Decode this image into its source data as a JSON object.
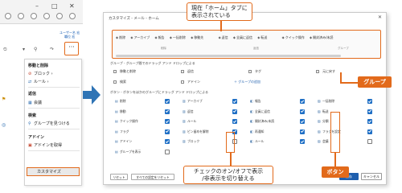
{
  "left": {
    "window_controls": [
      "–",
      "□",
      "✕"
    ],
    "user_line1": "ユーザー名 宏",
    "user_line2": "職位 宏",
    "more_button": "···",
    "menu": {
      "move_delete_header": "移動と削除",
      "block": "ブロック",
      "rule": "ルール",
      "reply_header": "返信",
      "meeting": "会議",
      "search_header": "検索",
      "find_group": "グループを見つける",
      "addin_header": "アドイン",
      "get_addins": "アドインを取得",
      "customize": "カスタマイズ"
    }
  },
  "dialog": {
    "title": "カスタマイズ - メール - ホーム",
    "qat_items": [
      "削除",
      "アーカイブ",
      "報告",
      "一括削除",
      "移動先",
      "返信",
      "全員に返信",
      "転送",
      "クイック操作",
      "開封済み/未読"
    ],
    "qat_groups": [
      "削除",
      "返信",
      "グループ"
    ],
    "groups_label": "グループ - グループ間でのドラッグ アンド ドロップによる",
    "groups": [
      "移動と削除",
      "返信",
      "タグ",
      "元に戻す",
      "検索",
      "アドイン",
      "＋ グループの追加"
    ],
    "buttons_label": "ボタン - ボタンをほかのグループにドラッグ アンド ドロップによる",
    "buttons": [
      [
        {
          "label": "削除",
          "on": true
        },
        {
          "label": "アーカイブ",
          "on": true
        },
        {
          "label": "報告",
          "on": true
        },
        {
          "label": "一括削除",
          "on": true
        }
      ],
      [
        {
          "label": "移動",
          "on": true
        },
        {
          "label": "返信",
          "on": true
        },
        {
          "label": "全員に返信",
          "on": true
        },
        {
          "label": "転送",
          "on": true
        }
      ],
      [
        {
          "label": "クイック操作",
          "on": true
        },
        {
          "label": "ルール",
          "on": true
        },
        {
          "label": "開封済み/未読",
          "on": true
        },
        {
          "label": "分類",
          "on": true
        }
      ],
      [
        {
          "label": "フラグ",
          "on": true
        },
        {
          "label": "ピン留めを解除",
          "on": true
        },
        {
          "label": "再通知",
          "on": true
        },
        {
          "label": "フラグを設定",
          "on": true
        }
      ],
      [
        {
          "label": "アドイン",
          "on": true
        },
        {
          "label": "ブロック",
          "on": false
        },
        {
          "label": "ルール",
          "on": true
        },
        {
          "label": "会議",
          "on": false
        }
      ],
      [
        {
          "label": "グループを表示",
          "on": false
        }
      ]
    ],
    "reset_label": "リセット",
    "reset_all_label": "すべての設定をリセット",
    "save_label": "保存",
    "cancel_label": "キャンセル"
  },
  "annotations": {
    "home_tab_line1": "現在「ホーム」タブに",
    "home_tab_line2": "表示されている",
    "group_tag": "グループ",
    "checkbox_line1": "チェックのオン/オフで表示",
    "checkbox_line2": "/非表示を切り替える",
    "button_tag": "ボタン"
  },
  "colors": {
    "accent": "#e26a1b",
    "checkbox": "#1f6fc5",
    "primary": "#1f5fae"
  }
}
